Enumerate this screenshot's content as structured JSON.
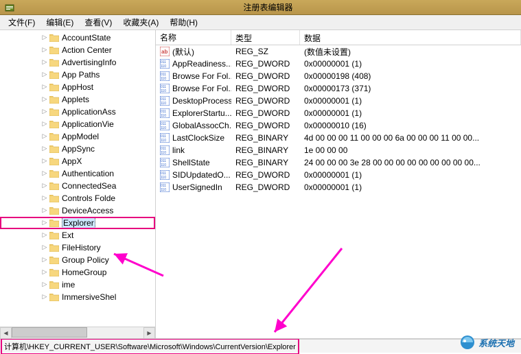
{
  "window": {
    "title": "注册表编辑器"
  },
  "menu": {
    "file": "文件(F)",
    "edit": "编辑(E)",
    "view": "查看(V)",
    "favorites": "收藏夹(A)",
    "help": "帮助(H)"
  },
  "tree": {
    "items": [
      {
        "label": "AccountState"
      },
      {
        "label": "Action Center"
      },
      {
        "label": "AdvertisingInfo"
      },
      {
        "label": "App Paths"
      },
      {
        "label": "AppHost"
      },
      {
        "label": "Applets"
      },
      {
        "label": "ApplicationAss"
      },
      {
        "label": "ApplicationVie"
      },
      {
        "label": "AppModel"
      },
      {
        "label": "AppSync"
      },
      {
        "label": "AppX"
      },
      {
        "label": "Authentication"
      },
      {
        "label": "ConnectedSea"
      },
      {
        "label": "Controls Folde"
      },
      {
        "label": "DeviceAccess"
      },
      {
        "label": "Explorer",
        "selected": true
      },
      {
        "label": "Ext"
      },
      {
        "label": "FileHistory"
      },
      {
        "label": "Group Policy"
      },
      {
        "label": "HomeGroup"
      },
      {
        "label": "ime"
      },
      {
        "label": "ImmersiveShel"
      }
    ]
  },
  "list": {
    "headers": {
      "name": "名称",
      "type": "类型",
      "data": "数据"
    },
    "rows": [
      {
        "icon": "ab",
        "name": "(默认)",
        "type": "REG_SZ",
        "data": "(数值未设置)"
      },
      {
        "icon": "bin",
        "name": "AppReadiness...",
        "type": "REG_DWORD",
        "data": "0x00000001 (1)"
      },
      {
        "icon": "bin",
        "name": "Browse For Fol...",
        "type": "REG_DWORD",
        "data": "0x00000198 (408)"
      },
      {
        "icon": "bin",
        "name": "Browse For Fol...",
        "type": "REG_DWORD",
        "data": "0x00000173 (371)"
      },
      {
        "icon": "bin",
        "name": "DesktopProcess",
        "type": "REG_DWORD",
        "data": "0x00000001 (1)"
      },
      {
        "icon": "bin",
        "name": "ExplorerStartu...",
        "type": "REG_DWORD",
        "data": "0x00000001 (1)"
      },
      {
        "icon": "bin",
        "name": "GlobalAssocCh...",
        "type": "REG_DWORD",
        "data": "0x00000010 (16)"
      },
      {
        "icon": "bin",
        "name": "LastClockSize",
        "type": "REG_BINARY",
        "data": "4d 00 00 00 11 00 00 00 6a 00 00 00 11 00 00..."
      },
      {
        "icon": "bin",
        "name": "link",
        "type": "REG_BINARY",
        "data": "1e 00 00 00"
      },
      {
        "icon": "bin",
        "name": "ShellState",
        "type": "REG_BINARY",
        "data": "24 00 00 00 3e 28 00 00 00 00 00 00 00 00 00..."
      },
      {
        "icon": "bin",
        "name": "SIDUpdatedO...",
        "type": "REG_DWORD",
        "data": "0x00000001 (1)"
      },
      {
        "icon": "bin",
        "name": "UserSignedIn",
        "type": "REG_DWORD",
        "data": "0x00000001 (1)"
      }
    ]
  },
  "statusbar": {
    "path": "计算机\\HKEY_CURRENT_USER\\Software\\Microsoft\\Windows\\CurrentVersion\\Explorer"
  },
  "watermark": {
    "text": "系统天地"
  }
}
